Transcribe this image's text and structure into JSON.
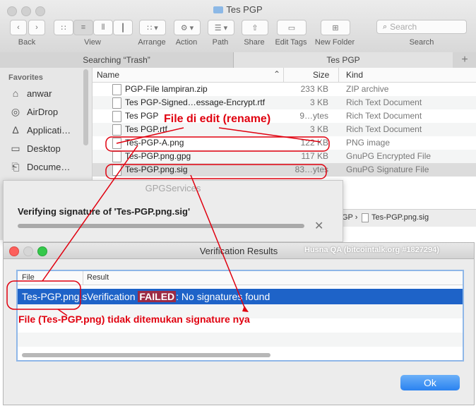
{
  "finder": {
    "title": "Tes PGP",
    "toolbar": {
      "back": "Back",
      "view": "View",
      "arrange": "Arrange",
      "action": "Action",
      "path": "Path",
      "share": "Share",
      "edit_tags": "Edit Tags",
      "new_folder": "New Folder",
      "search_placeholder": "Search",
      "search": "Search"
    },
    "tabs": [
      "Searching “Trash”",
      "Tes PGP"
    ],
    "sidebar": {
      "heading": "Favorites",
      "items": [
        {
          "label": "anwar",
          "icon": "home-icon"
        },
        {
          "label": "AirDrop",
          "icon": "airdrop-icon"
        },
        {
          "label": "Applicati…",
          "icon": "applications-icon"
        },
        {
          "label": "Desktop",
          "icon": "desktop-icon"
        },
        {
          "label": "Docume…",
          "icon": "documents-icon"
        }
      ]
    },
    "columns": {
      "name": "Name",
      "size": "Size",
      "kind": "Kind"
    },
    "files": [
      {
        "name": "PGP-File lampiran.zip",
        "size": "233 KB",
        "kind": "ZIP archive"
      },
      {
        "name": "Tes PGP-Signed…essage-Encrypt.rtf",
        "size": "3 KB",
        "kind": "Rich Text Document"
      },
      {
        "name": "Tes PGP",
        "size": "9…ytes",
        "kind": "Rich Text Document"
      },
      {
        "name": "Tes PGP.rtf",
        "size": "3 KB",
        "kind": "Rich Text Document"
      },
      {
        "name": "Tes-PGP-A.png",
        "size": "122 KB",
        "kind": "PNG image"
      },
      {
        "name": "Tes-PGP.png.gpg",
        "size": "117 KB",
        "kind": "GnuPG Encrypted File"
      },
      {
        "name": "Tes-PGP.png.sig",
        "size": "83…ytes",
        "kind": "GnuPG Signature File"
      }
    ],
    "path_bar": {
      "prefix": "GP ›",
      "file": "Tes-PGP.png.sig"
    }
  },
  "gpg_dialog": {
    "title": "GPGServices",
    "message": "Verifying signature of 'Tes-PGP.png.sig'",
    "progress": 1.0
  },
  "verification": {
    "title": "Verification Results",
    "watermark": "Husna QA (bitcointalk.org #1827294)",
    "columns": {
      "file": "File",
      "result": "Result"
    },
    "row": {
      "file": "Tes-PGP.png.s",
      "result_prefix": "Verification ",
      "failed": "FAILED",
      "result_suffix": ": No signatures found"
    },
    "ok_button": "Ok"
  },
  "annotations": {
    "rename": "File di edit (rename)",
    "no_signature": "File (Tes-PGP.png) tidak ditemukan signature nya"
  },
  "colors": {
    "annotation": "#e0000f",
    "selection": "#1e63c8",
    "failed_bg": "#9c2b45"
  }
}
